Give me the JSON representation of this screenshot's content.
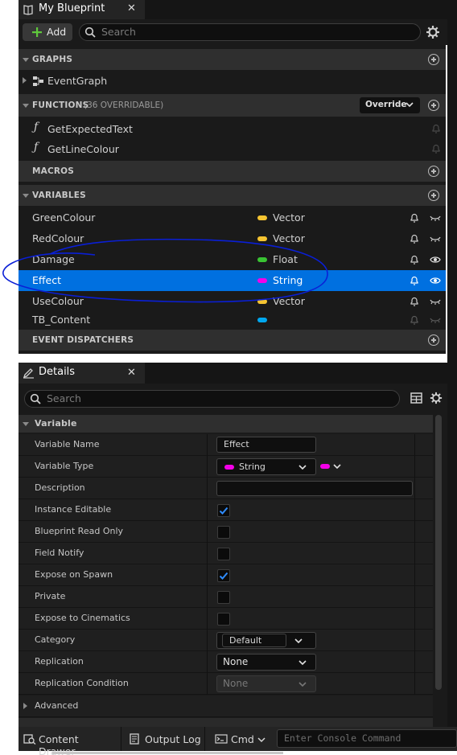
{
  "blueprint_panel": {
    "tab_title": "My Blueprint",
    "add_label": "Add",
    "search_placeholder": "Search",
    "graphs": {
      "label": "GRAPHS",
      "items": [
        "EventGraph"
      ]
    },
    "functions": {
      "label": "FUNCTIONS",
      "count_label": "(36 OVERRIDABLE)",
      "override_label": "Override",
      "items": [
        "GetExpectedText",
        "GetLineColour"
      ]
    },
    "macros": {
      "label": "MACROS"
    },
    "variables": {
      "label": "VARIABLES",
      "items": [
        {
          "name": "GreenColour",
          "type": "Vector",
          "color": "#f5c431",
          "eye": "closed",
          "selected": false
        },
        {
          "name": "RedColour",
          "type": "Vector",
          "color": "#f5c431",
          "eye": "closed",
          "selected": false
        },
        {
          "name": "Damage",
          "type": "Float",
          "color": "#39c433",
          "eye": "open",
          "selected": false
        },
        {
          "name": "Effect",
          "type": "String",
          "color": "#f400e8",
          "eye": "open",
          "selected": true
        },
        {
          "name": "UseColour",
          "type": "Vector",
          "color": "#f5c431",
          "eye": "closed",
          "selected": false
        },
        {
          "name": "TB_Content",
          "type": "",
          "color": "#00a8f0",
          "eye": "closed",
          "selected": false
        }
      ]
    },
    "event_dispatchers": {
      "label": "EVENT DISPATCHERS"
    }
  },
  "details_panel": {
    "tab_title": "Details",
    "search_placeholder": "Search",
    "section_label": "Variable",
    "rows": [
      {
        "label": "Variable Name",
        "kind": "text",
        "value": "Effect"
      },
      {
        "label": "Variable Type",
        "kind": "type",
        "value": "String"
      },
      {
        "label": "Description",
        "kind": "textwide",
        "value": ""
      },
      {
        "label": "Instance Editable",
        "kind": "check",
        "checked": true
      },
      {
        "label": "Blueprint Read Only",
        "kind": "check",
        "checked": false
      },
      {
        "label": "Field Notify",
        "kind": "check",
        "checked": false
      },
      {
        "label": "Expose on Spawn",
        "kind": "check",
        "checked": true
      },
      {
        "label": "Private",
        "kind": "check",
        "checked": false
      },
      {
        "label": "Expose to Cinematics",
        "kind": "check",
        "checked": false
      },
      {
        "label": "Category",
        "kind": "combo",
        "value": "Default"
      },
      {
        "label": "Replication",
        "kind": "select",
        "value": "None"
      },
      {
        "label": "Replication Condition",
        "kind": "select-disabled",
        "value": "None"
      }
    ],
    "advanced_label": "Advanced"
  },
  "bottom_bar": {
    "content_drawer": "Content Drawer",
    "output_log": "Output Log",
    "cmd": "Cmd",
    "console_placeholder": "Enter Console Command"
  },
  "colors": {
    "selection": "#0070e0",
    "accent_add": "#5fc93c",
    "annotation": "#0a1fd6"
  }
}
